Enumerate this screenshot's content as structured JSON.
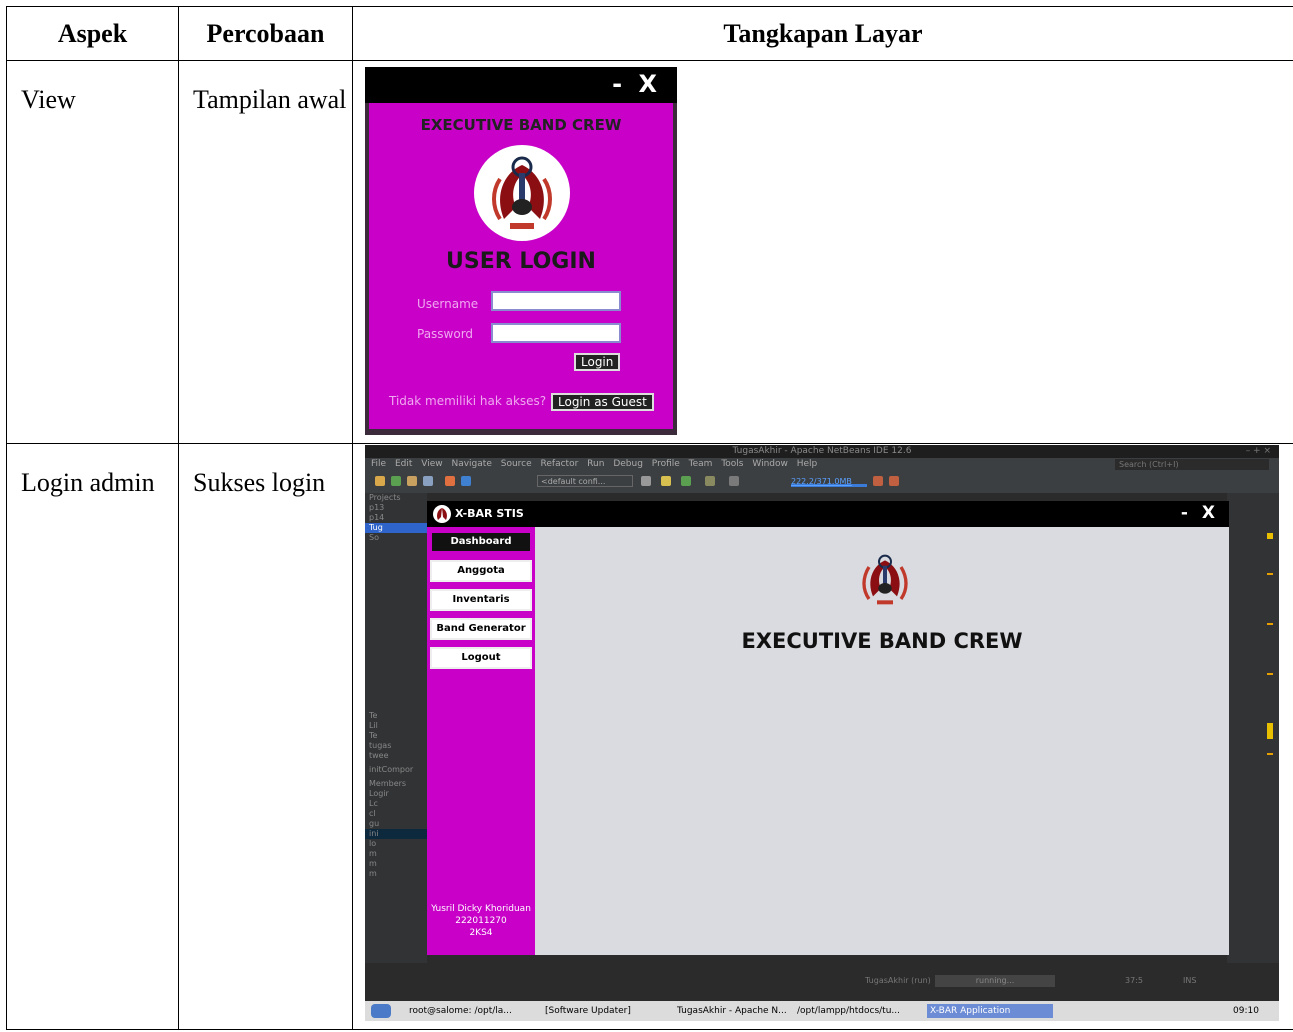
{
  "table": {
    "headers": [
      "Aspek",
      "Percobaan",
      "Tangkapan Layar"
    ],
    "rows": [
      {
        "aspek": "View",
        "percobaan": "Tampilan awal"
      },
      {
        "aspek": "Login admin",
        "percobaan": "Sukses login"
      }
    ]
  },
  "login_window": {
    "window_controls": "- X",
    "brand": "EXECUTIVE BAND CREW",
    "title": "USER LOGIN",
    "username_label": "Username",
    "password_label": "Password",
    "username_value": "",
    "password_value": "",
    "login_button": "Login",
    "no_access_text": "Tidak memiliki hak akses?",
    "guest_button": "Login as Guest",
    "colors": {
      "panel": "#c800c8",
      "titlebar": "#000000"
    }
  },
  "netbeans": {
    "title": "TugasAkhir - Apache NetBeans IDE 12.6",
    "menu": [
      "File",
      "Edit",
      "View",
      "Navigate",
      "Source",
      "Refactor",
      "Run",
      "Debug",
      "Profile",
      "Team",
      "Tools",
      "Window",
      "Help"
    ],
    "search_placeholder": "Search (Ctrl+I)",
    "config": "<default confi...",
    "memory": "222.2/371.0MB",
    "projects_tab": "Projects",
    "tree": [
      "p13",
      "p14",
      "Tug",
      "So",
      "",
      "",
      "",
      "",
      "",
      "",
      "",
      "",
      "",
      "",
      "",
      "",
      "",
      "",
      "",
      "",
      "Te",
      "Lil",
      "Te",
      "tugas",
      "twee"
    ],
    "init_label": "initCompor",
    "members_label": "Members",
    "members": [
      "Logir",
      "Lc",
      "cl",
      "gu",
      "ini",
      "lo",
      "m",
      "m",
      "m"
    ],
    "status_run": "TugasAkhir (run)",
    "status_running": "running...",
    "position": "37:5",
    "mode": "INS"
  },
  "app": {
    "title": "X-BAR STIS",
    "window_controls": "- X",
    "menu": [
      "Dashboard",
      "Anggota",
      "Inventaris",
      "Band Generator",
      "Logout"
    ],
    "active_menu": "Dashboard",
    "user_name": "Yusril Dicky Khoriduan",
    "user_nim": "222011270",
    "user_class": "2KS4",
    "brand": "EXECUTIVE BAND CREW",
    "colors": {
      "sidebar": "#c800c8",
      "main": "#d9dbe0"
    }
  },
  "taskbar": {
    "items": [
      "root@salome: /opt/la...",
      "[Software Updater]",
      "TugasAkhir - Apache N...",
      "/opt/lampp/htdocs/tu...",
      "X-BAR Application"
    ],
    "clock": "09:10"
  }
}
